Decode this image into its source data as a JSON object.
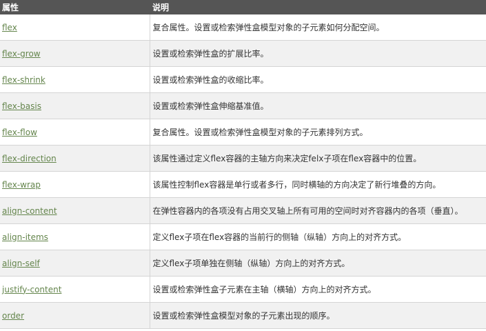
{
  "header": {
    "col_property": "属性",
    "col_description": "说明"
  },
  "rows": [
    {
      "property": "flex",
      "description": "复合属性。设置或检索弹性盒模型对象的子元素如何分配空间。"
    },
    {
      "property": "flex-grow",
      "description": "设置或检索弹性盒的扩展比率。"
    },
    {
      "property": "flex-shrink",
      "description": "设置或检索弹性盒的收缩比率。"
    },
    {
      "property": "flex-basis",
      "description": "设置或检索弹性盒伸缩基准值。"
    },
    {
      "property": "flex-flow",
      "description": "复合属性。设置或检索弹性盒模型对象的子元素排列方式。"
    },
    {
      "property": "flex-direction",
      "description": "该属性通过定义flex容器的主轴方向来决定felx子项在flex容器中的位置。"
    },
    {
      "property": "flex-wrap",
      "description": "该属性控制flex容器是单行或者多行，同时横轴的方向决定了新行堆叠的方向。"
    },
    {
      "property": "align-content",
      "description": "在弹性容器内的各项没有占用交叉轴上所有可用的空间时对齐容器内的各项（垂直）。"
    },
    {
      "property": "align-items",
      "description": "定义flex子项在flex容器的当前行的侧轴（纵轴）方向上的对齐方式。"
    },
    {
      "property": "align-self",
      "description": "定义flex子项单独在侧轴（纵轴）方向上的对齐方式。"
    },
    {
      "property": "justify-content",
      "description": "设置或检索弹性盒子元素在主轴（横轴）方向上的对齐方式。"
    },
    {
      "property": "order",
      "description": "设置或检索弹性盒模型对象的子元素出现的顺序。"
    }
  ]
}
